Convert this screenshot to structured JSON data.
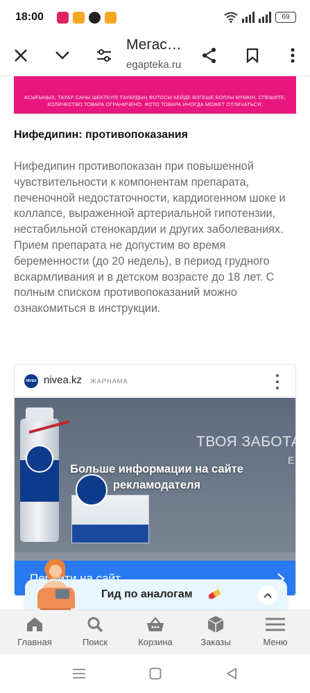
{
  "status_bar": {
    "time": "18:00",
    "battery": "69",
    "app_colors": [
      "#e0245e",
      "#f5a623",
      "#222222",
      "#f5a623"
    ]
  },
  "browser": {
    "title": "Мегас…",
    "url": "egapteka.ru",
    "icons": [
      "close-icon",
      "chevron-down-icon",
      "filter-settings-icon",
      "share-icon",
      "bookmark-icon",
      "more-vertical-icon"
    ]
  },
  "banner": {
    "top_text": "",
    "disclaimer": "АСЫҒЫҢЫЗ, ТАУАР САНЫ ШЕКТЕУЛІ ТАУАРДЫҢ ФОТОСЫ КЕЙДЕ ӨЗГЕШЕ БОЛУЫ МҮМКІН. СПЕШИТЕ, КОЛИЧЕСТВО ТОВАРА ОГРАНИЧЕНО. ФОТО ТОВАРА ИНОГДА МОЖЕТ ОТЛИЧАТЬСЯ.",
    "color": "#e8177f"
  },
  "article": {
    "section_title": "Нифедипин: противопоказания",
    "paragraph": "Нифедипин противопоказан при повышенной чувствительности к компонентам препарата, печеночной недостаточности, кардиогенном шоке и коллапсе, выраженной артериальной гипотензии, нестабильной стенокардии и других заболеваниях. Прием препарата не допустим во время беременности (до 20 недель), в период грудного вскармливания и в детском возрасте до 18 лет. С полным списком противопоказаний можно ознакомиться в инструкции."
  },
  "ad": {
    "logo_text": "NIVEA",
    "domain": "nivea.kz",
    "label": "ЖАРНАМА",
    "slogan": "ТВОЯ ЗАБОТА",
    "slogan_tail": "Е",
    "overlay": "Больше информации на сайте рекламодателя",
    "cta": "Перейти на сайт",
    "cta_color": "#2979f2"
  },
  "analog_guide": {
    "label": "Гид по аналогам",
    "icon": "pill-icon"
  },
  "bottom_nav": {
    "items": [
      {
        "label": "Главная",
        "icon": "home-icon"
      },
      {
        "label": "Поиск",
        "icon": "search-icon"
      },
      {
        "label": "Корзина",
        "icon": "basket-icon"
      },
      {
        "label": "Заказы",
        "icon": "box-icon"
      },
      {
        "label": "Меню",
        "icon": "hamburger-icon"
      }
    ]
  },
  "system_nav": {
    "icons": [
      "recents-icon",
      "home-square-icon",
      "back-triangle-icon"
    ]
  }
}
